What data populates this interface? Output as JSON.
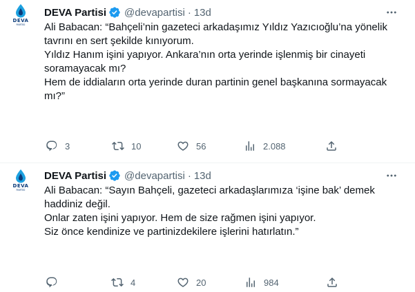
{
  "tweets": [
    {
      "author": {
        "name": "DEVA Partisi",
        "handle": "@devapartisi",
        "time": "13d",
        "avatar_brand": "DEVA",
        "avatar_sub": "PARTİSİ"
      },
      "text": {
        "p1_l1": "Ali Babacan: “Bahçeli’nin gazeteci arkadaşımız Yıldız Yazıcıoğlu’na yönelik",
        "p1_l2": "tavrını en sert şekilde kınıyorum.",
        "p2_l1": "Yıldız Hanım işini yapıyor. Ankara’nın orta yerinde işlenmiş bir cinayeti",
        "p2_l2": "soramayacak mı?",
        "p3_l1": "Hem de iddiaların orta yerinde duran partinin genel başkanına sormayacak",
        "p3_l2": "mı?”"
      },
      "stats": {
        "replies": "3",
        "retweets": "10",
        "likes": "56",
        "views": "2.088"
      }
    },
    {
      "author": {
        "name": "DEVA Partisi",
        "handle": "@devapartisi",
        "time": "13d",
        "avatar_brand": "DEVA",
        "avatar_sub": "PARTİSİ"
      },
      "text": {
        "p1_l1": "Ali Babacan: “Sayın Bahçeli, gazeteci arkadaşlarımıza ‘işine bak’ demek",
        "p1_l2": "haddiniz değil.",
        "p2_l1": "Onlar zaten işini yapıyor. Hem de size rağmen işini yapıyor.",
        "p3_l1": "Siz önce kendinize ve partinizdekilere işlerini hatırlatın.”"
      },
      "stats": {
        "replies": "",
        "retweets": "4",
        "likes": "20",
        "views": "984"
      }
    }
  ],
  "colors": {
    "text": "#0f1419",
    "secondary": "#536471",
    "verified": "#1d9bf0",
    "brand": "#0b3b7a",
    "divider": "#eff3f4"
  },
  "icons": [
    "more-icon",
    "verified-badge-icon",
    "reply-icon",
    "retweet-icon",
    "like-icon",
    "views-icon",
    "share-icon",
    "deva-logo-icon"
  ]
}
